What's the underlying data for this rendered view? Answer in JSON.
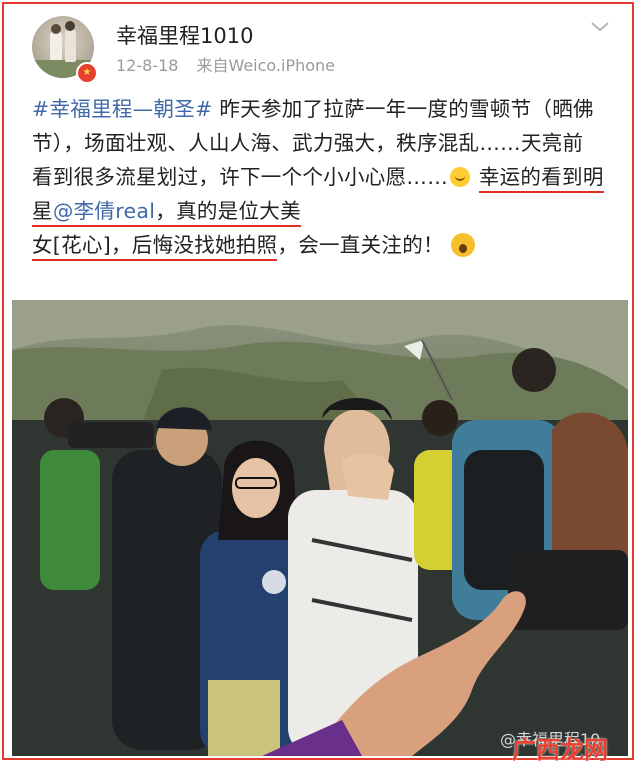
{
  "post": {
    "username": "幸福里程1010",
    "date": "12-8-18",
    "source": "来自Weico.iPhone",
    "hashtag": "#幸福里程—朝圣#",
    "text_part1": "昨天参加了拉萨一年一度的雪顿节（晒佛节），场面壮观、人山人海、武力强大，秩序混乱……天亮前看到很多流星划过，许下一个个小小心愿……",
    "text_part2": "幸运的看到明星",
    "mention": "@李倩real",
    "text_part3": "，真的是位大美",
    "text_part4": "女[花心]，后悔没找她拍照",
    "text_part5": "，会一直关注的！"
  },
  "photo": {
    "watermark": "@幸福里程10",
    "site_mark": "广西龙网"
  },
  "colors": {
    "link": "#4169a8",
    "underline": "#e22d22",
    "frame": "#e23b2e"
  },
  "icons": {
    "more": "chevron-down-icon",
    "badge": "vip-badge-icon",
    "emoji1": "smiling-emoji-icon",
    "emoji2": "surprised-emoji-icon"
  }
}
